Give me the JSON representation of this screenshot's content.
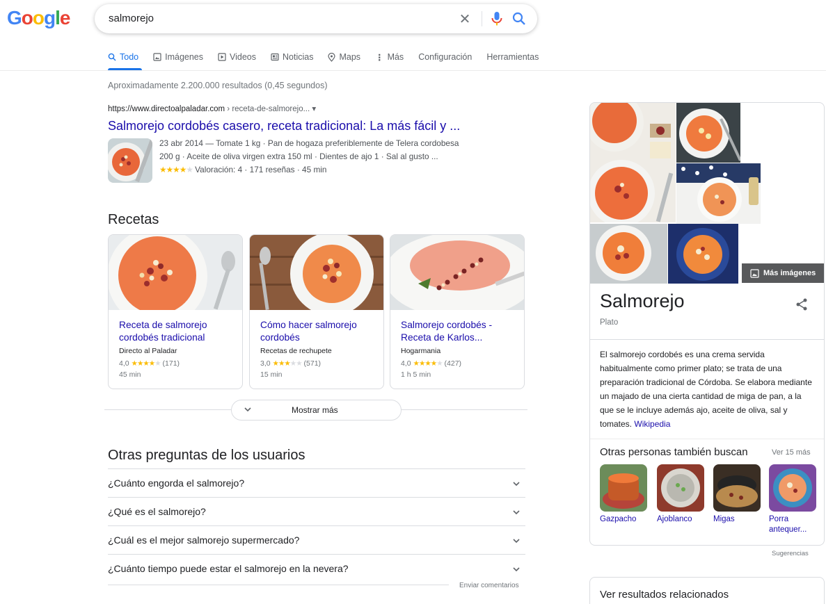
{
  "header": {
    "logo_text": "Google",
    "query": "salmorejo"
  },
  "tabs": [
    {
      "label": "Todo",
      "icon": "search-icon",
      "active": true
    },
    {
      "label": "Imágenes",
      "icon": "image-icon"
    },
    {
      "label": "Videos",
      "icon": "play-icon"
    },
    {
      "label": "Noticias",
      "icon": "news-icon"
    },
    {
      "label": "Maps",
      "icon": "map-pin-icon"
    },
    {
      "label": "Más",
      "icon": "more-vert-icon"
    },
    {
      "label": "Configuración"
    },
    {
      "label": "Herramientas"
    }
  ],
  "stats": "Aproximadamente 2.200.000 resultados (0,45 segundos)",
  "result1": {
    "domain": "https://www.directoalpaladar.com",
    "path": " › receta-de-salmorejo... ▾",
    "title": "Salmorejo cordobés casero, receta tradicional: La más fácil y ...",
    "line1": "23 abr 2014 — Tomate 1 kg · Pan de hogaza preferiblemente de Telera cordobesa",
    "line2": "200 g · Aceite de oliva virgen extra 150 ml · Dientes de ajo 1 · Sal al gusto ...",
    "rating_text": "Valoración: 4 · 171 reseñas · 45 min",
    "rating": 4
  },
  "recipes": {
    "heading": "Recetas",
    "items": [
      {
        "title": "Receta de salmorejo cordobés tradicional",
        "source": "Directo al Paladar",
        "score": "4,0",
        "stars": 4,
        "reviews": "(171)",
        "time": "45 min"
      },
      {
        "title": "Cómo hacer salmorejo cordobés",
        "source": "Recetas de rechupete",
        "score": "3,0",
        "stars": 3,
        "reviews": "(571)",
        "time": "15 min"
      },
      {
        "title": "Salmorejo cordobés - Receta de Karlos...",
        "source": "Hogarmania",
        "score": "4,0",
        "stars": 4,
        "reviews": "(427)",
        "time": "1 h 5 min"
      }
    ],
    "show_more": "Mostrar más"
  },
  "paa": {
    "heading": "Otras preguntas de los usuarios",
    "questions": [
      "¿Cuánto engorda el salmorejo?",
      "¿Qué es el salmorejo?",
      "¿Cuál es el mejor salmorejo supermercado?",
      "¿Cuánto tiempo puede estar el salmorejo en la nevera?"
    ],
    "feedback": "Enviar comentarios"
  },
  "knowledge_panel": {
    "more_images": "Más imágenes",
    "title": "Salmorejo",
    "subtitle": "Plato",
    "description": "El salmorejo cordobés es una crema servida habitualmente como primer plato; se trata de una preparación tradicional de Córdoba. Se elabora mediante un majado de una cierta cantidad de miga de pan,  a la que se le incluye además ajo, aceite de oliva, sal y tomates.",
    "wiki": "Wikipedia",
    "also_search": "Otras personas también buscan",
    "see_more": "Ver 15 más",
    "related": [
      "Gazpacho",
      "Ajoblanco",
      "Migas",
      "Porra antequer..."
    ],
    "suggestions": "Sugerencias",
    "related_results": "Ver resultados relacionados"
  },
  "colors": {
    "link": "#1a0dab",
    "accent": "#1a73e8",
    "star": "#fbbc04"
  }
}
